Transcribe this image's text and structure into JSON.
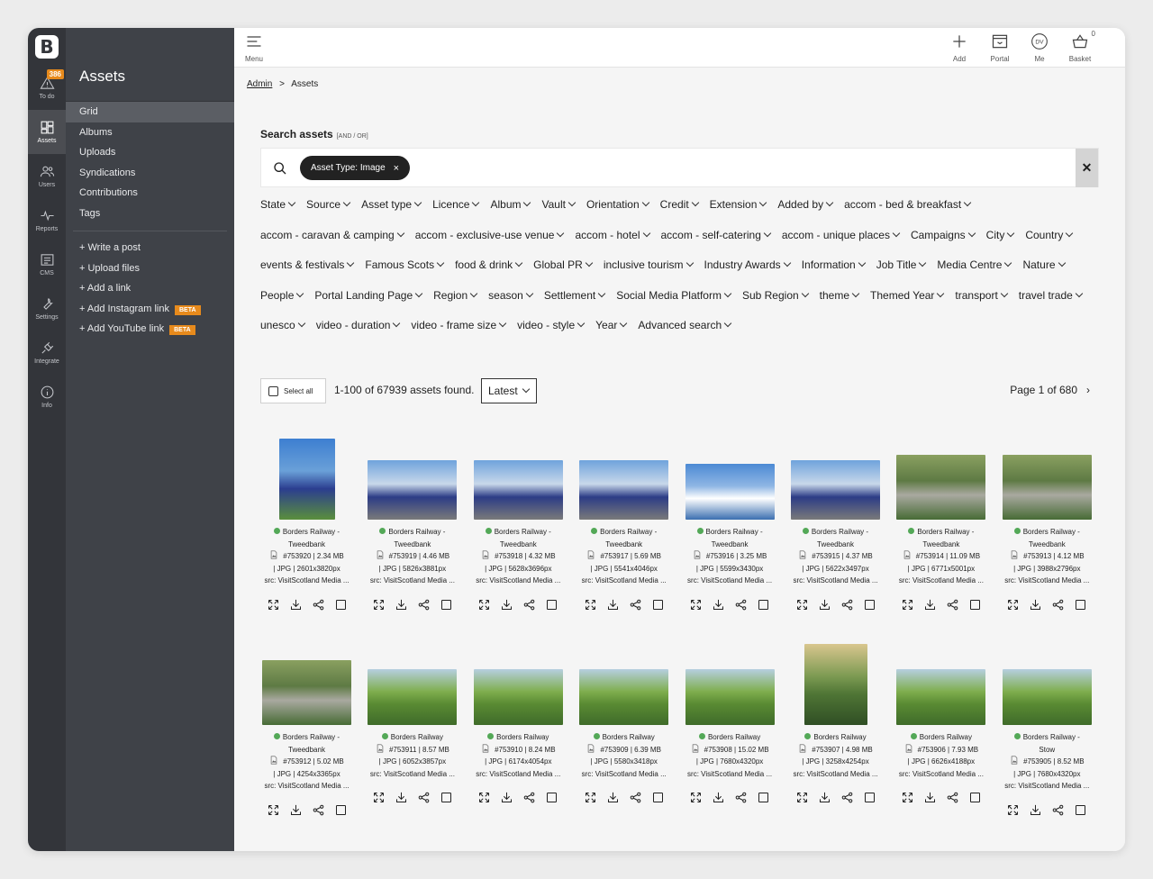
{
  "rail": {
    "badge": "386",
    "items": [
      {
        "label": "To do",
        "icon": "warning-icon"
      },
      {
        "label": "Assets",
        "icon": "grid-icon"
      },
      {
        "label": "Users",
        "icon": "users-icon"
      },
      {
        "label": "Reports",
        "icon": "pulse-icon"
      },
      {
        "label": "CMS",
        "icon": "cms-icon"
      },
      {
        "label": "Settings",
        "icon": "wrench-icon"
      },
      {
        "label": "Integrate",
        "icon": "plug-icon"
      },
      {
        "label": "Info",
        "icon": "info-icon"
      }
    ]
  },
  "sidenav": {
    "title": "Assets",
    "items": [
      "Grid",
      "Albums",
      "Uploads",
      "Syndications",
      "Contributions",
      "Tags"
    ],
    "actions": [
      "+ Write a post",
      "+ Upload files",
      "+ Add a link",
      "+ Add Instagram link",
      "+ Add YouTube link"
    ],
    "beta": "BETA"
  },
  "topbar": {
    "menu": "Menu",
    "add": "Add",
    "portal": "Portal",
    "me": "Me",
    "me_initials": "DV",
    "basket": "Basket",
    "basket_count": "0"
  },
  "breadcrumb": {
    "root": "Admin",
    "sep": ">",
    "current": "Assets"
  },
  "search": {
    "title": "Search assets",
    "mode": "[AND / OR]",
    "chip": "Asset Type: Image",
    "chip_x": "×",
    "clear": "✕"
  },
  "filters": [
    "State",
    "Source",
    "Asset type",
    "Licence",
    "Album",
    "Vault",
    "Orientation",
    "Credit",
    "Extension",
    "Added by",
    "accom - bed & breakfast",
    "accom - caravan & camping",
    "accom - exclusive-use venue",
    "accom - hotel",
    "accom - self-catering",
    "accom - unique places",
    "Campaigns",
    "City",
    "Country",
    "events & festivals",
    "Famous Scots",
    "food & drink",
    "Global PR",
    "inclusive tourism",
    "Industry Awards",
    "Information",
    "Job Title",
    "Media Centre",
    "Nature",
    "People",
    "Portal Landing Page",
    "Region",
    "season",
    "Settlement",
    "Social Media Platform",
    "Sub Region",
    "theme",
    "Themed Year",
    "transport",
    "travel trade",
    "unesco",
    "video - duration",
    "video - frame size",
    "video - style",
    "Year",
    "Advanced search"
  ],
  "toolbar": {
    "select_all": "Select all",
    "count": "1-100 of 67939 assets found.",
    "sort": "Latest",
    "page": "Page 1 of 680",
    "next": "›"
  },
  "assets": [
    {
      "title1": "Borders Railway -",
      "title2": "Tweedbank",
      "meta1": "#753920 | 2.34 MB",
      "meta2": "| JPG | 2601x3820px",
      "src": "src: VisitScotland Media ...",
      "kind": "train-portrait"
    },
    {
      "title1": "Borders Railway -",
      "title2": "Tweedbank",
      "meta1": "#753919 | 4.46 MB",
      "meta2": "| JPG | 5826x3881px",
      "src": "src: VisitScotland Media ...",
      "kind": "train"
    },
    {
      "title1": "Borders Railway -",
      "title2": "Tweedbank",
      "meta1": "#753918 | 4.32 MB",
      "meta2": "| JPG | 5628x3696px",
      "src": "src: VisitScotland Media ...",
      "kind": "train"
    },
    {
      "title1": "Borders Railway -",
      "title2": "Tweedbank",
      "meta1": "#753917 | 5.69 MB",
      "meta2": "| JPG | 5541x4046px",
      "src": "src: VisitScotland Media ...",
      "kind": "train"
    },
    {
      "title1": "Borders Railway -",
      "title2": "Tweedbank",
      "meta1": "#753916 | 3.25 MB",
      "meta2": "| JPG | 5599x3430px",
      "src": "src: VisitScotland Media ...",
      "kind": "sign"
    },
    {
      "title1": "Borders Railway -",
      "title2": "Tweedbank",
      "meta1": "#753915 | 4.37 MB",
      "meta2": "| JPG | 5622x3497px",
      "src": "src: VisitScotland Media ...",
      "kind": "train"
    },
    {
      "title1": "Borders Railway -",
      "title2": "Tweedbank",
      "meta1": "#753914 | 11.09 MB",
      "meta2": "| JPG | 6771x5001px",
      "src": "src: VisitScotland Media ...",
      "kind": "aerial"
    },
    {
      "title1": "Borders Railway -",
      "title2": "Tweedbank",
      "meta1": "#753913 | 4.12 MB",
      "meta2": "| JPG | 3988x2796px",
      "src": "src: VisitScotland Media ...",
      "kind": "aerial"
    },
    {
      "title1": "Borders Railway -",
      "title2": "Tweedbank",
      "meta1": "#753912 | 5.02 MB",
      "meta2": "| JPG | 4254x3365px",
      "src": "src: VisitScotland Media ...",
      "kind": "aerial"
    },
    {
      "title1": "Borders Railway",
      "title2": "",
      "meta1": "#753911 | 8.57 MB",
      "meta2": "| JPG | 6052x3857px",
      "src": "src: VisitScotland Media ...",
      "kind": "green"
    },
    {
      "title1": "Borders Railway",
      "title2": "",
      "meta1": "#753910 | 8.24 MB",
      "meta2": "| JPG | 6174x4054px",
      "src": "src: VisitScotland Media ...",
      "kind": "green"
    },
    {
      "title1": "Borders Railway",
      "title2": "",
      "meta1": "#753909 | 6.39 MB",
      "meta2": "| JPG | 5580x3418px",
      "src": "src: VisitScotland Media ...",
      "kind": "green"
    },
    {
      "title1": "Borders Railway",
      "title2": "",
      "meta1": "#753908 | 15.02 MB",
      "meta2": "| JPG | 7680x4320px",
      "src": "src: VisitScotland Media ...",
      "kind": "green"
    },
    {
      "title1": "Borders Railway",
      "title2": "",
      "meta1": "#753907 | 4.98 MB",
      "meta2": "| JPG | 3258x4254px",
      "src": "src: VisitScotland Media ...",
      "kind": "green-portrait"
    },
    {
      "title1": "Borders Railway",
      "title2": "",
      "meta1": "#753906 | 7.93 MB",
      "meta2": "| JPG | 6626x4188px",
      "src": "src: VisitScotland Media ...",
      "kind": "green"
    },
    {
      "title1": "Borders Railway -",
      "title2": "Stow",
      "meta1": "#753905 | 8.52 MB",
      "meta2": "| JPG | 7680x4320px",
      "src": "src: VisitScotland Media ...",
      "kind": "green"
    }
  ],
  "colors": {
    "accent": "#e78a1c",
    "dot": "#53a857",
    "rail": "#33353a",
    "sidenav": "#3f4248"
  }
}
